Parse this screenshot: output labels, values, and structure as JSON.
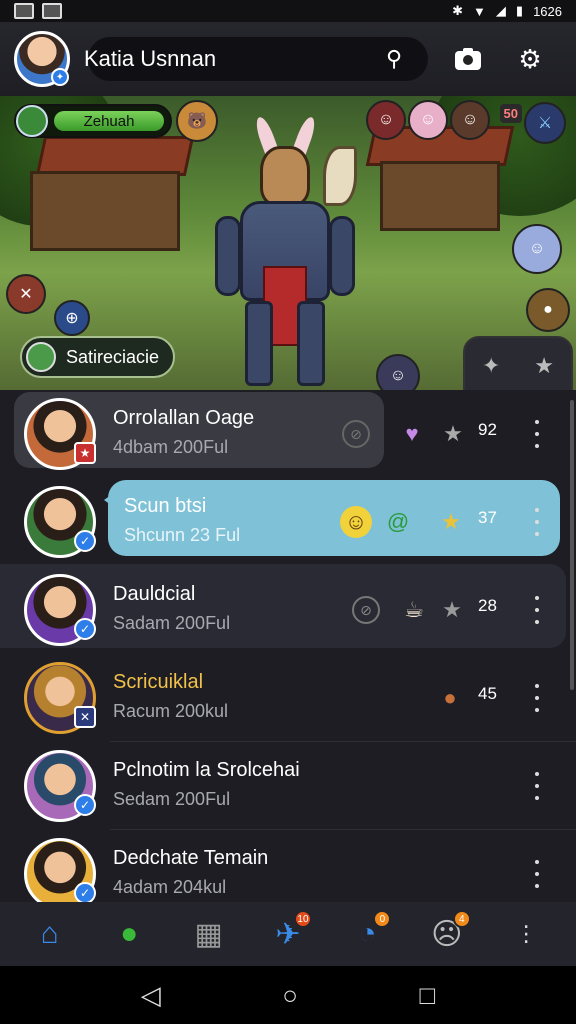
{
  "status_bar": {
    "time": "1626"
  },
  "header": {
    "username": "Katia Usnnan",
    "search_icon": "search-icon",
    "camera_icon": "camera-icon",
    "settings_icon": "gear-icon"
  },
  "scene": {
    "xp_label": "Zehuah",
    "level_tag": "50",
    "location_label": "Satireciacie"
  },
  "list": {
    "rows": [
      {
        "name": "Orrolallan Oage",
        "sub": "4dbam 200Ful",
        "count": "92"
      },
      {
        "name": "Scun btsi",
        "sub": "Shcunn 23 Ful",
        "count": "37"
      },
      {
        "name": "Dauldcial",
        "sub": "Sadam 200Ful",
        "count": "28"
      },
      {
        "name": "Scricuiklal",
        "sub": "Racum 200kul",
        "count": "45"
      },
      {
        "name": "Pclnotim la Srolcehai",
        "sub": "Sedam 200Ful",
        "count": ""
      },
      {
        "name": "Dedchate Temain",
        "sub": "4adam 204kul",
        "count": ""
      }
    ],
    "highlight_color": "#f2c14a",
    "accent": "#7fc2d8"
  },
  "nav": {
    "items": [
      "home-icon",
      "leaf-icon",
      "house-icon",
      "bird-icon",
      "clock-icon",
      "emoji-icon",
      "more-icon"
    ],
    "badges": {
      "bird": "10",
      "clock": "0",
      "emoji": "4"
    }
  }
}
